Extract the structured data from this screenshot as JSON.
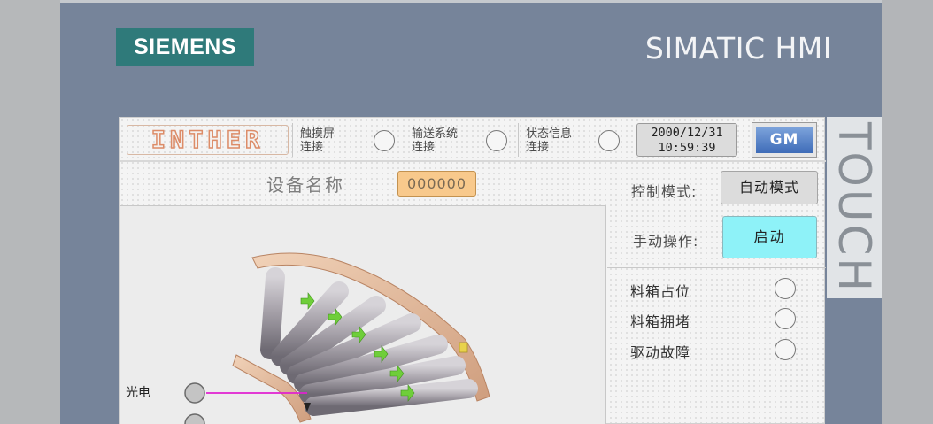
{
  "device": {
    "brand": "SIEMENS",
    "product": "SIMATIC HMI",
    "side_label": "TOUCH"
  },
  "header": {
    "logo_text": "INTHER",
    "touch_conn_label": "触摸屏\n连接",
    "conveyor_conn_label": "输送系统\n连接",
    "status_conn_label": "状态信息\n连接",
    "date": "2000/12/31",
    "time": "10:59:39",
    "gm_label": "GM"
  },
  "main": {
    "device_name_label": "设备名称",
    "device_name_value": "000000",
    "control_mode_label": "控制模式:",
    "control_mode_value": "自动模式",
    "manual_op_label": "手动操作:",
    "start_label": "启动"
  },
  "alarms": [
    {
      "label": "料箱占位"
    },
    {
      "label": "料箱拥堵"
    },
    {
      "label": "驱动故障"
    }
  ],
  "sensors": {
    "photo_label": "光电"
  },
  "colors": {
    "frame": "#76849a",
    "siemens_teal": "#2f7a7a",
    "start_cyan": "#8ef2f8",
    "device_value_bg": "#f8c98c",
    "sensor_line": "#e020d0"
  }
}
